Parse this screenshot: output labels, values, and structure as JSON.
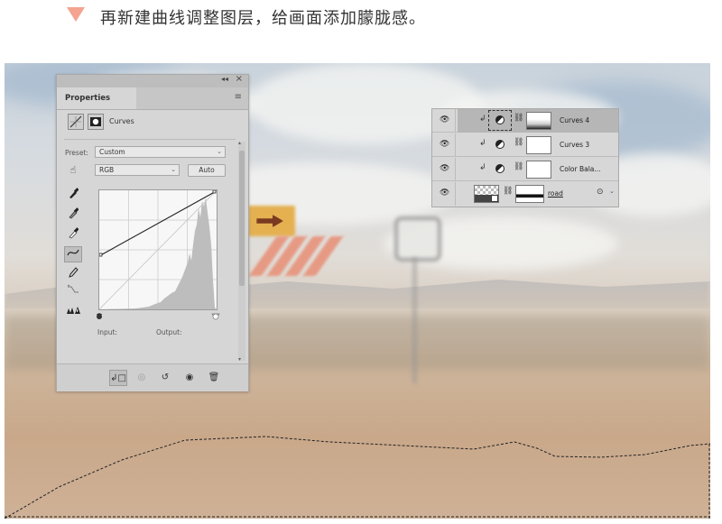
{
  "header": {
    "text": "再新建曲线调整图层，给画面添加朦胧感。",
    "accent": "#f3a38f"
  },
  "properties_panel": {
    "tab": "Properties",
    "adjustment_label": "Curves",
    "preset_label": "Preset:",
    "preset_value": "Custom",
    "channel_value": "RGB",
    "auto_label": "Auto",
    "input_label": "Input:",
    "output_label": "Output:",
    "tools": [
      "on-image-adjust-icon",
      "black-eyedropper-icon",
      "gray-eyedropper-icon",
      "white-eyedropper-icon",
      "curve-points-icon",
      "pencil-icon",
      "smooth-icon",
      "clipping-warning-icon"
    ],
    "bottom_icons": [
      "clip-to-layer-icon",
      "view-previous-icon",
      "reset-icon",
      "visibility-icon",
      "delete-icon"
    ]
  },
  "layers_panel": {
    "layers": [
      {
        "name": "Curves 4",
        "selected": true
      },
      {
        "name": "Curves 3",
        "selected": false
      },
      {
        "name": "Color Bala...",
        "selected": false
      },
      {
        "name": "road",
        "selected": false
      }
    ]
  }
}
